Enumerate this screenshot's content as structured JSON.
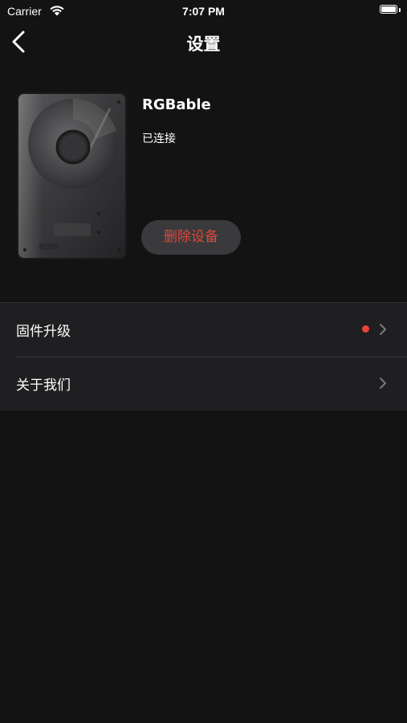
{
  "status_bar": {
    "carrier": "Carrier",
    "time": "7:07 PM",
    "icons": [
      "wifi-icon",
      "battery-icon"
    ]
  },
  "nav": {
    "title": "设置",
    "back_icon": "chevron-left-icon"
  },
  "device": {
    "name": "RGBable",
    "status": "已连接",
    "image": "hard-drive-device-image",
    "delete_label": "删除设备"
  },
  "settings": {
    "items": [
      {
        "label": "固件升级",
        "has_badge": true,
        "icon": "chevron-right-icon"
      },
      {
        "label": "关于我们",
        "has_badge": false,
        "icon": "chevron-right-icon"
      }
    ]
  },
  "colors": {
    "background": "#131314",
    "list_background": "#1f1f21",
    "button_background": "#3a3a3c",
    "danger": "#e0473c",
    "badge": "#e8453a"
  }
}
